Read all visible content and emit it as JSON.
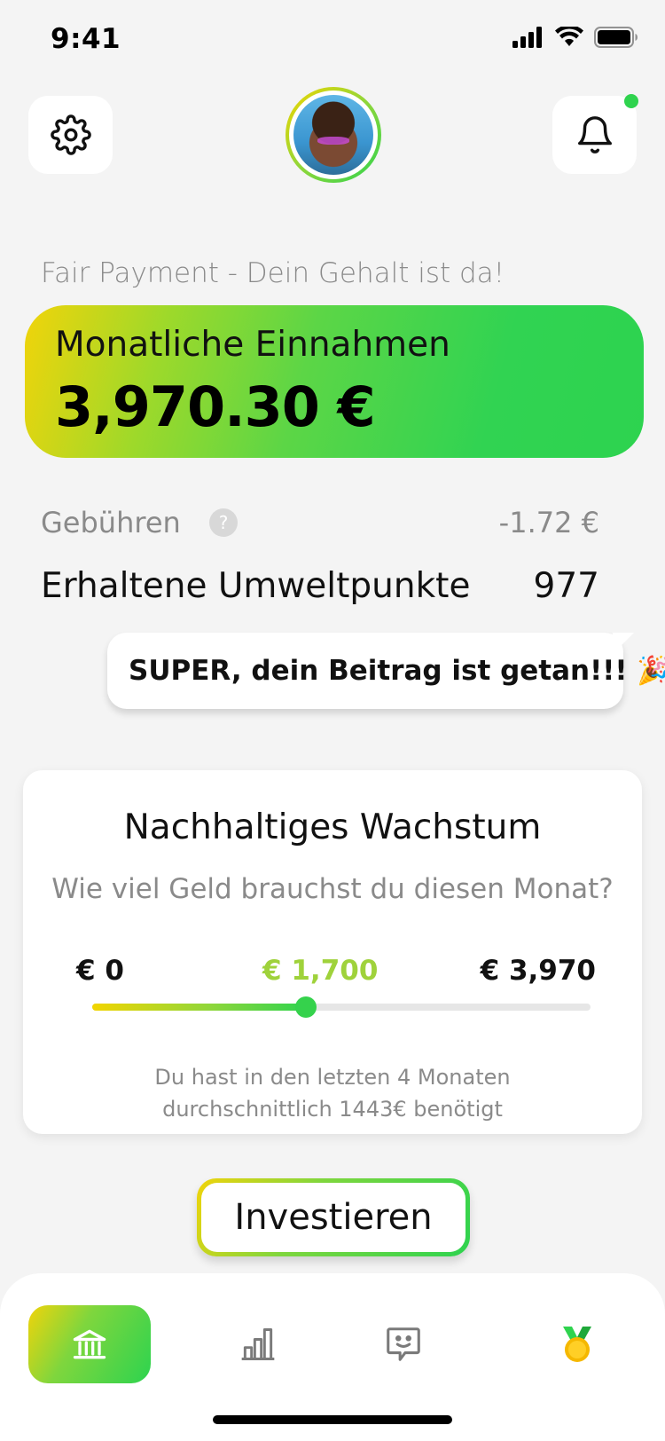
{
  "status_bar": {
    "time": "9:41"
  },
  "header": {
    "settings_icon": "gear-icon",
    "notifications_icon": "bell-icon",
    "has_notification": true
  },
  "income": {
    "subtitle": "Fair Payment - Dein Gehalt ist da!",
    "label": "Monatliche Einnahmen",
    "amount": "3,970.30 €"
  },
  "fees": {
    "label": "Gebühren",
    "help": "?",
    "value": "-1.72 €"
  },
  "points": {
    "label": "Erhaltene Umweltpunkte",
    "value": "977"
  },
  "bubble": {
    "text": "SUPER, dein Beitrag ist getan!!! 🎉"
  },
  "growth": {
    "title": "Nachhaltiges Wachstum",
    "question": "Wie viel Geld brauchst du diesen Monat?",
    "slider": {
      "min_label": "€ 0",
      "current_label": "€ 1,700",
      "max_label": "€ 3,970",
      "min": 0,
      "value": 1700,
      "max": 3970
    },
    "hint_line1": "Du hast in den letzten 4 Monaten",
    "hint_line2": "durchschnittlich 1443€ benötigt"
  },
  "invest_button": {
    "label": "Investieren"
  },
  "bottom_nav": {
    "items": [
      {
        "icon": "bank-icon",
        "active": true
      },
      {
        "icon": "bar-chart-icon",
        "active": false
      },
      {
        "icon": "chat-face-icon",
        "active": false
      },
      {
        "icon": "medal-icon",
        "active": false
      }
    ]
  },
  "colors": {
    "accent_green": "#2fd34e",
    "accent_yellow": "#f1d40a",
    "slider_value": "#9fd23b",
    "muted_text": "#8a8a8a",
    "background": "#f4f4f4"
  }
}
